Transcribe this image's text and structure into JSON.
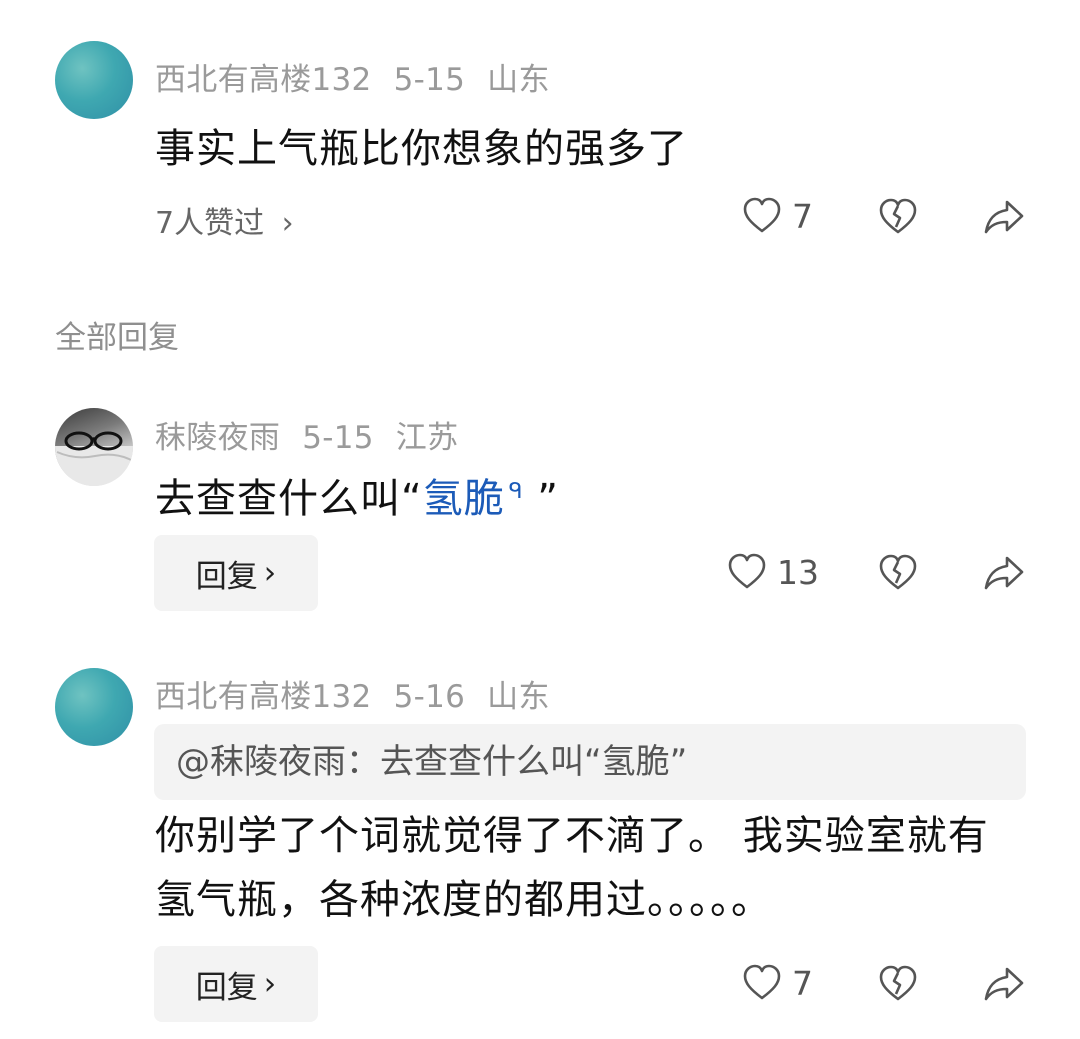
{
  "comments": [
    {
      "user": "西北有高楼132",
      "date": "5-15",
      "location": "山东",
      "text": "事实上气瓶比你想象的强多了",
      "likers_text": "7人赞过",
      "like_count": "7"
    },
    {
      "user": "秣陵夜雨",
      "date": "5-15",
      "location": "江苏",
      "text_prefix": "去查查什么叫“",
      "link_text": "氢脆",
      "search_glyph": "ᑫ",
      "text_suffix": " ”",
      "reply_label": "回复",
      "like_count": "13"
    },
    {
      "user": "西北有高楼132",
      "date": "5-16",
      "location": "山东",
      "quote": "@秣陵夜雨：去查查什么叫“氢脆”",
      "text": "你别学了个词就觉得了不滴了。 我实验室就有氢气瓶，各种浓度的都用过。。。。。",
      "reply_label": "回复",
      "like_count": "7"
    }
  ],
  "section_title": "全部回复",
  "chevron": "›",
  "icons": [
    "heart-icon",
    "broken-heart-icon",
    "share-icon",
    "chevron-right-icon"
  ]
}
